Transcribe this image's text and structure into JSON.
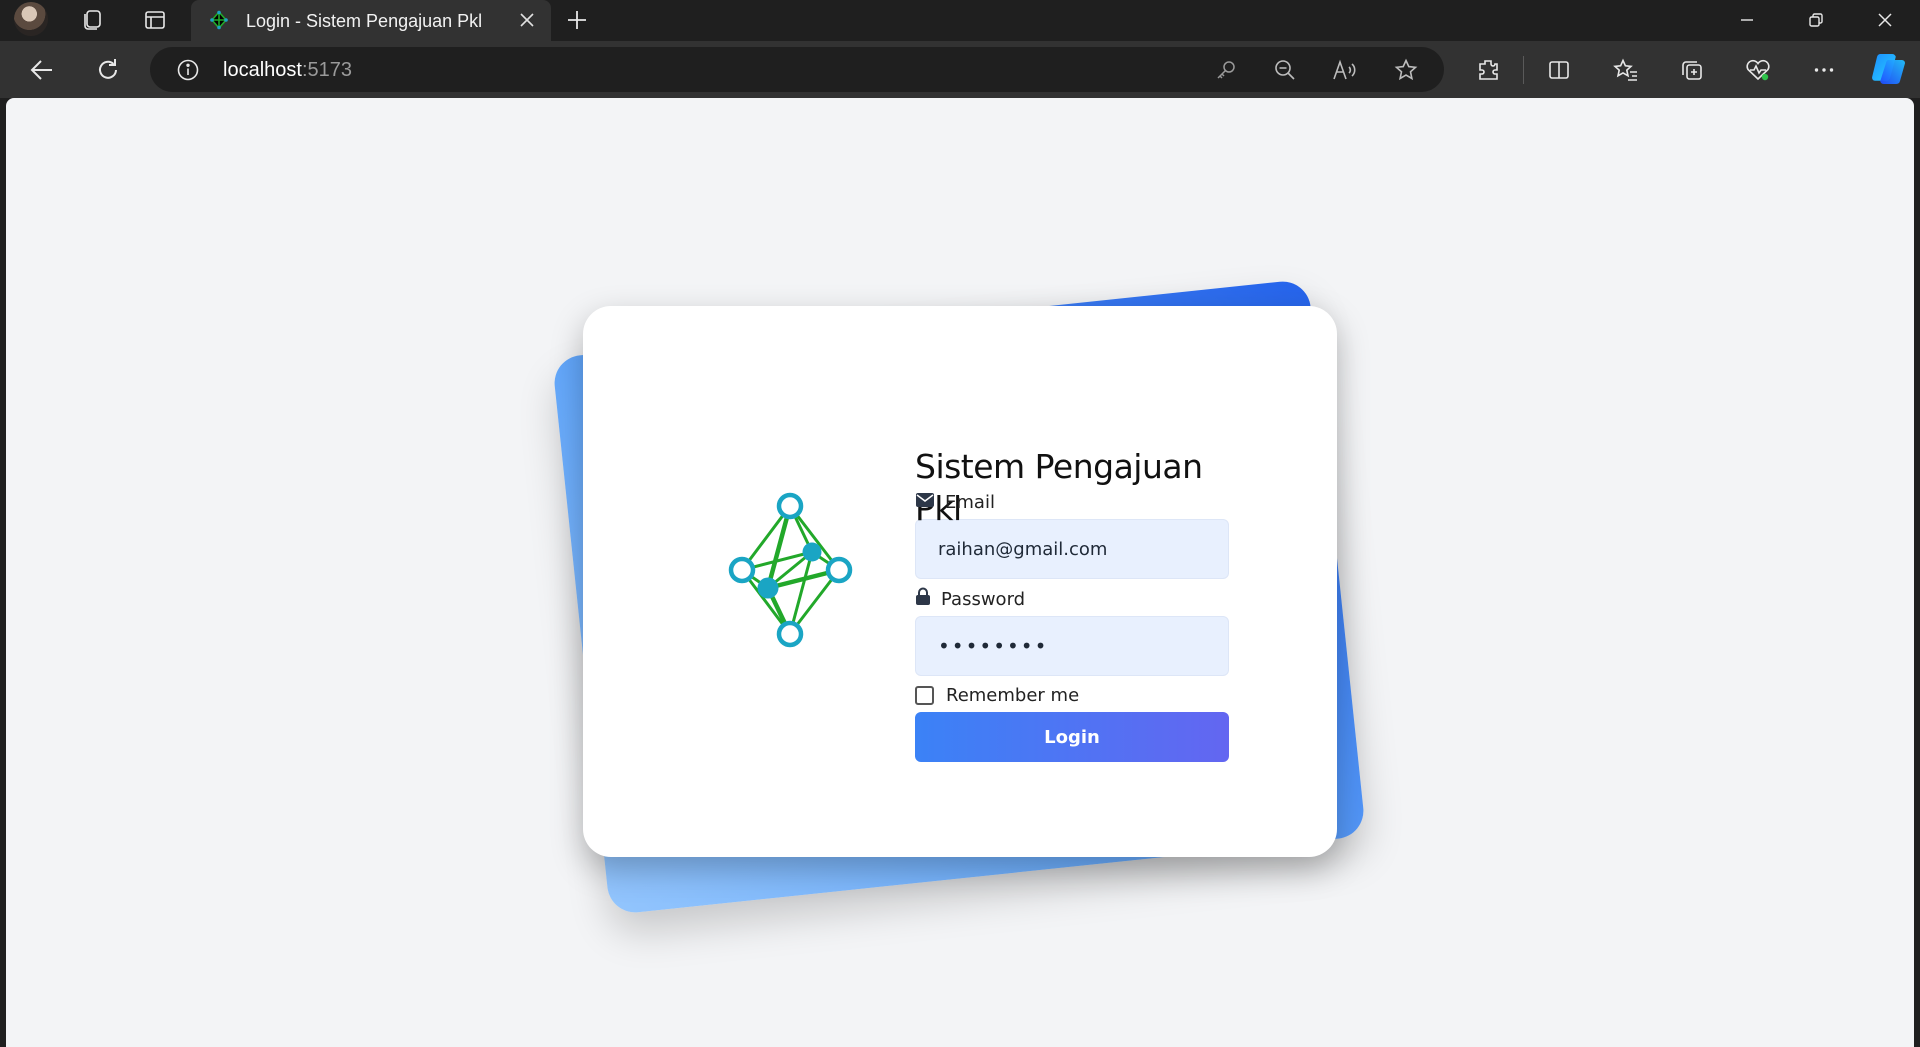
{
  "browser": {
    "tab_title": "Login - Sistem Pengajuan Pkl",
    "address_host": "localhost",
    "address_port": ":5173"
  },
  "login": {
    "title": "Sistem Pengajuan Pkl",
    "email_label": "Email",
    "email_value": "raihan@gmail.com",
    "password_label": "Password",
    "password_value": "••••••••",
    "remember_label": "Remember me",
    "remember_checked": false,
    "button_label": "Login"
  },
  "colors": {
    "button_gradient_start": "#3b82f6",
    "button_gradient_end": "#6366f1",
    "input_background": "#e8f0fe",
    "logo_green": "#22a82a",
    "logo_teal": "#1aa5c4"
  },
  "icons": [
    "profile-avatar",
    "workspaces-icon",
    "tab-actions-icon",
    "tab-favicon",
    "close-icon",
    "new-tab-icon",
    "minimize-icon",
    "restore-icon",
    "back-icon",
    "refresh-icon",
    "info-icon",
    "key-icon",
    "zoom-out-icon",
    "read-aloud-icon",
    "favorite-star-icon",
    "extensions-icon",
    "split-screen-icon",
    "favorites-icon",
    "collections-icon",
    "browser-essentials-icon",
    "more-icon",
    "copilot-icon",
    "envelope-icon",
    "lock-icon"
  ]
}
